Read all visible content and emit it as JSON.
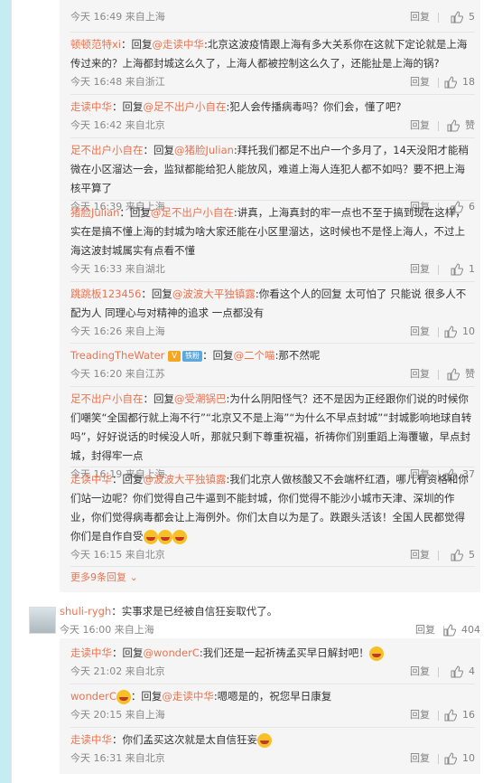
{
  "comments": [
    {
      "name": "",
      "text": "",
      "time": "今天 16:49 来自上海",
      "likes": "5"
    },
    {
      "name": "顿顿范特xi",
      "reply_to": "@走读中华",
      "text": ":北京这波疫情跟上海有多大关系你在这就下定论就是上海传过来的？上海都封城这么久了，上海人都被控制这么久了，还能扯是上海的锅?",
      "time": "今天 16:48 来自浙江",
      "likes": "18"
    },
    {
      "name": "走读中华",
      "reply_to": "@足不出户小自在",
      "text": ":犯人会传播病毒吗？你们会，懂了吧?",
      "time": "今天 16:42 来自北京",
      "likes": "赞"
    },
    {
      "name": "足不出户小自在",
      "reply_to": "@猪脸Julian",
      "text": ":拜托我们都足不出户一个多月了，14天没阳才能稍微在小区溜达一会，监狱都能给犯人能放风，难道上海人连犯人都不如吗？要不把上海核平算了",
      "time": "今天 16:39 来自上海",
      "likes": "6"
    },
    {
      "name": "猪脸Julian",
      "reply_to": "@足不出户小自在",
      "text": ":讲真，上海真封的牢一点也不至于搞到现在这样，实在是搞不懂上海的封城为啥大家还能在小区里溜达，这时候也不是怪上海人，不过上海这波封城属实有点看不懂",
      "time": "今天 16:33 来自湖北",
      "likes": "1"
    },
    {
      "name": "跳跳板123456",
      "reply_to": "@波波大平独镇露",
      "text": ":你看这个人的回复 太可怕了 只能说 很多人不配为人 同理心与对精神的追求 一点都没有",
      "time": "今天 16:26 来自上海",
      "likes": "10"
    },
    {
      "name": "TreadingTheWater",
      "badge_v": "V",
      "badge_fan": "铁粉",
      "reply_to": "@二个喵",
      "text": ":那不然呢",
      "time": "今天 16:20 来自江苏",
      "likes": "赞"
    },
    {
      "name": "足不出户小自在",
      "reply_to": "@受潮锅巴",
      "text": ":为什么阴阳怪气？还不是因为正经跟你们说的时候你们嘲笑“全国都行就上海不行”“北京又不是上海”“为什么不早点封城”“封城影响地球自转吗”，好好说话的时候没人听，那就只剩下尊重祝福，祈祷你们别重蹈上海覆辙，早点封城，封得牢一点",
      "time": "今天 16:19 来自上海",
      "likes": "37"
    },
    {
      "name": "走读中华",
      "reply_to": "@波波大平独镇露",
      "text": ":我们北京人做核酸又不会端杯红酒，哪儿有资格和你们站一边呢？你们觉得自己牛逼到不能封城，你们觉得不能沙小城市天津、深圳的作业，你们觉得病毒都会让上海例外。你们太自以为是了。跌跟头活该！全国人民都觉得你们是自作自受",
      "time": "今天 16:15 来自北京",
      "likes": "5"
    }
  ],
  "more_link": "更多9条回复",
  "main_comment": {
    "name": "shuli-rygh",
    "text": "：实事求是已经被自信狂妄取代了。",
    "time": "今天 16:00 来自上海",
    "likes": "404"
  },
  "replies2": [
    {
      "name": "走读中华",
      "reply_to": "@wonderC",
      "text": ":我们还是一起祈祷孟买早日解封吧！",
      "time": "今天 21:02 来自北京",
      "likes": "4"
    },
    {
      "name": "wonderC",
      "reply_to": "@走读中华",
      "text": ":嗯嗯是的，祝您早日康复",
      "time": "今天 20:15 来自上海",
      "likes": "16"
    },
    {
      "name": "走读中华",
      "reply_to": "",
      "text": "：你们孟买这次就是太自信狂妄",
      "time": "今天 16:31 来自北京",
      "likes": "10"
    }
  ],
  "labels": {
    "reply": "回复",
    "reply_prefix": "回复"
  },
  "colors": {
    "link": "#eb7350",
    "accent_bar": "#c5ecf2"
  }
}
